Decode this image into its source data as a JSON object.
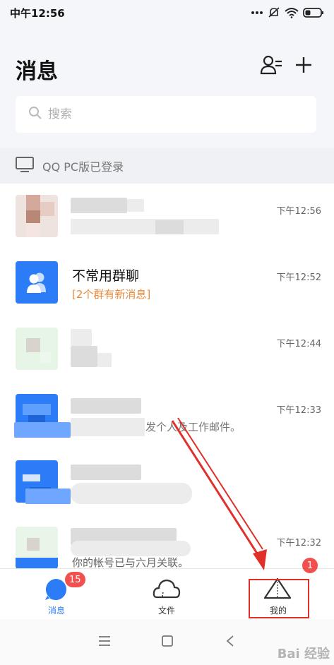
{
  "status_bar": {
    "time": "中午12:56"
  },
  "header": {
    "title": "消息"
  },
  "search": {
    "placeholder": "搜索"
  },
  "pc_banner": {
    "text": "QQ PC版已登录"
  },
  "messages": [
    {
      "name": "",
      "preview": "",
      "time": "下午12:56"
    },
    {
      "name": "不常用群聊",
      "preview": "[2个群有新消息]",
      "time": "下午12:52"
    },
    {
      "name": "",
      "preview": "",
      "time": "下午12:44"
    },
    {
      "name": "",
      "preview": "发个人及工作邮件。",
      "time": "下午12:33"
    },
    {
      "name": "",
      "preview": "",
      "time": ""
    },
    {
      "name": "",
      "preview": "你的帐号已与六月关联。",
      "time": "下午12:32"
    }
  ],
  "tabs": [
    {
      "label": "消息",
      "badge": "15"
    },
    {
      "label": "文件",
      "badge": ""
    },
    {
      "label": "我的",
      "badge": "1"
    }
  ],
  "watermark": "Bai 经验",
  "colors": {
    "accent": "#2b7cf6",
    "badge": "#f2504e",
    "highlight": "#e0302a",
    "orange": "#e98a3a"
  }
}
